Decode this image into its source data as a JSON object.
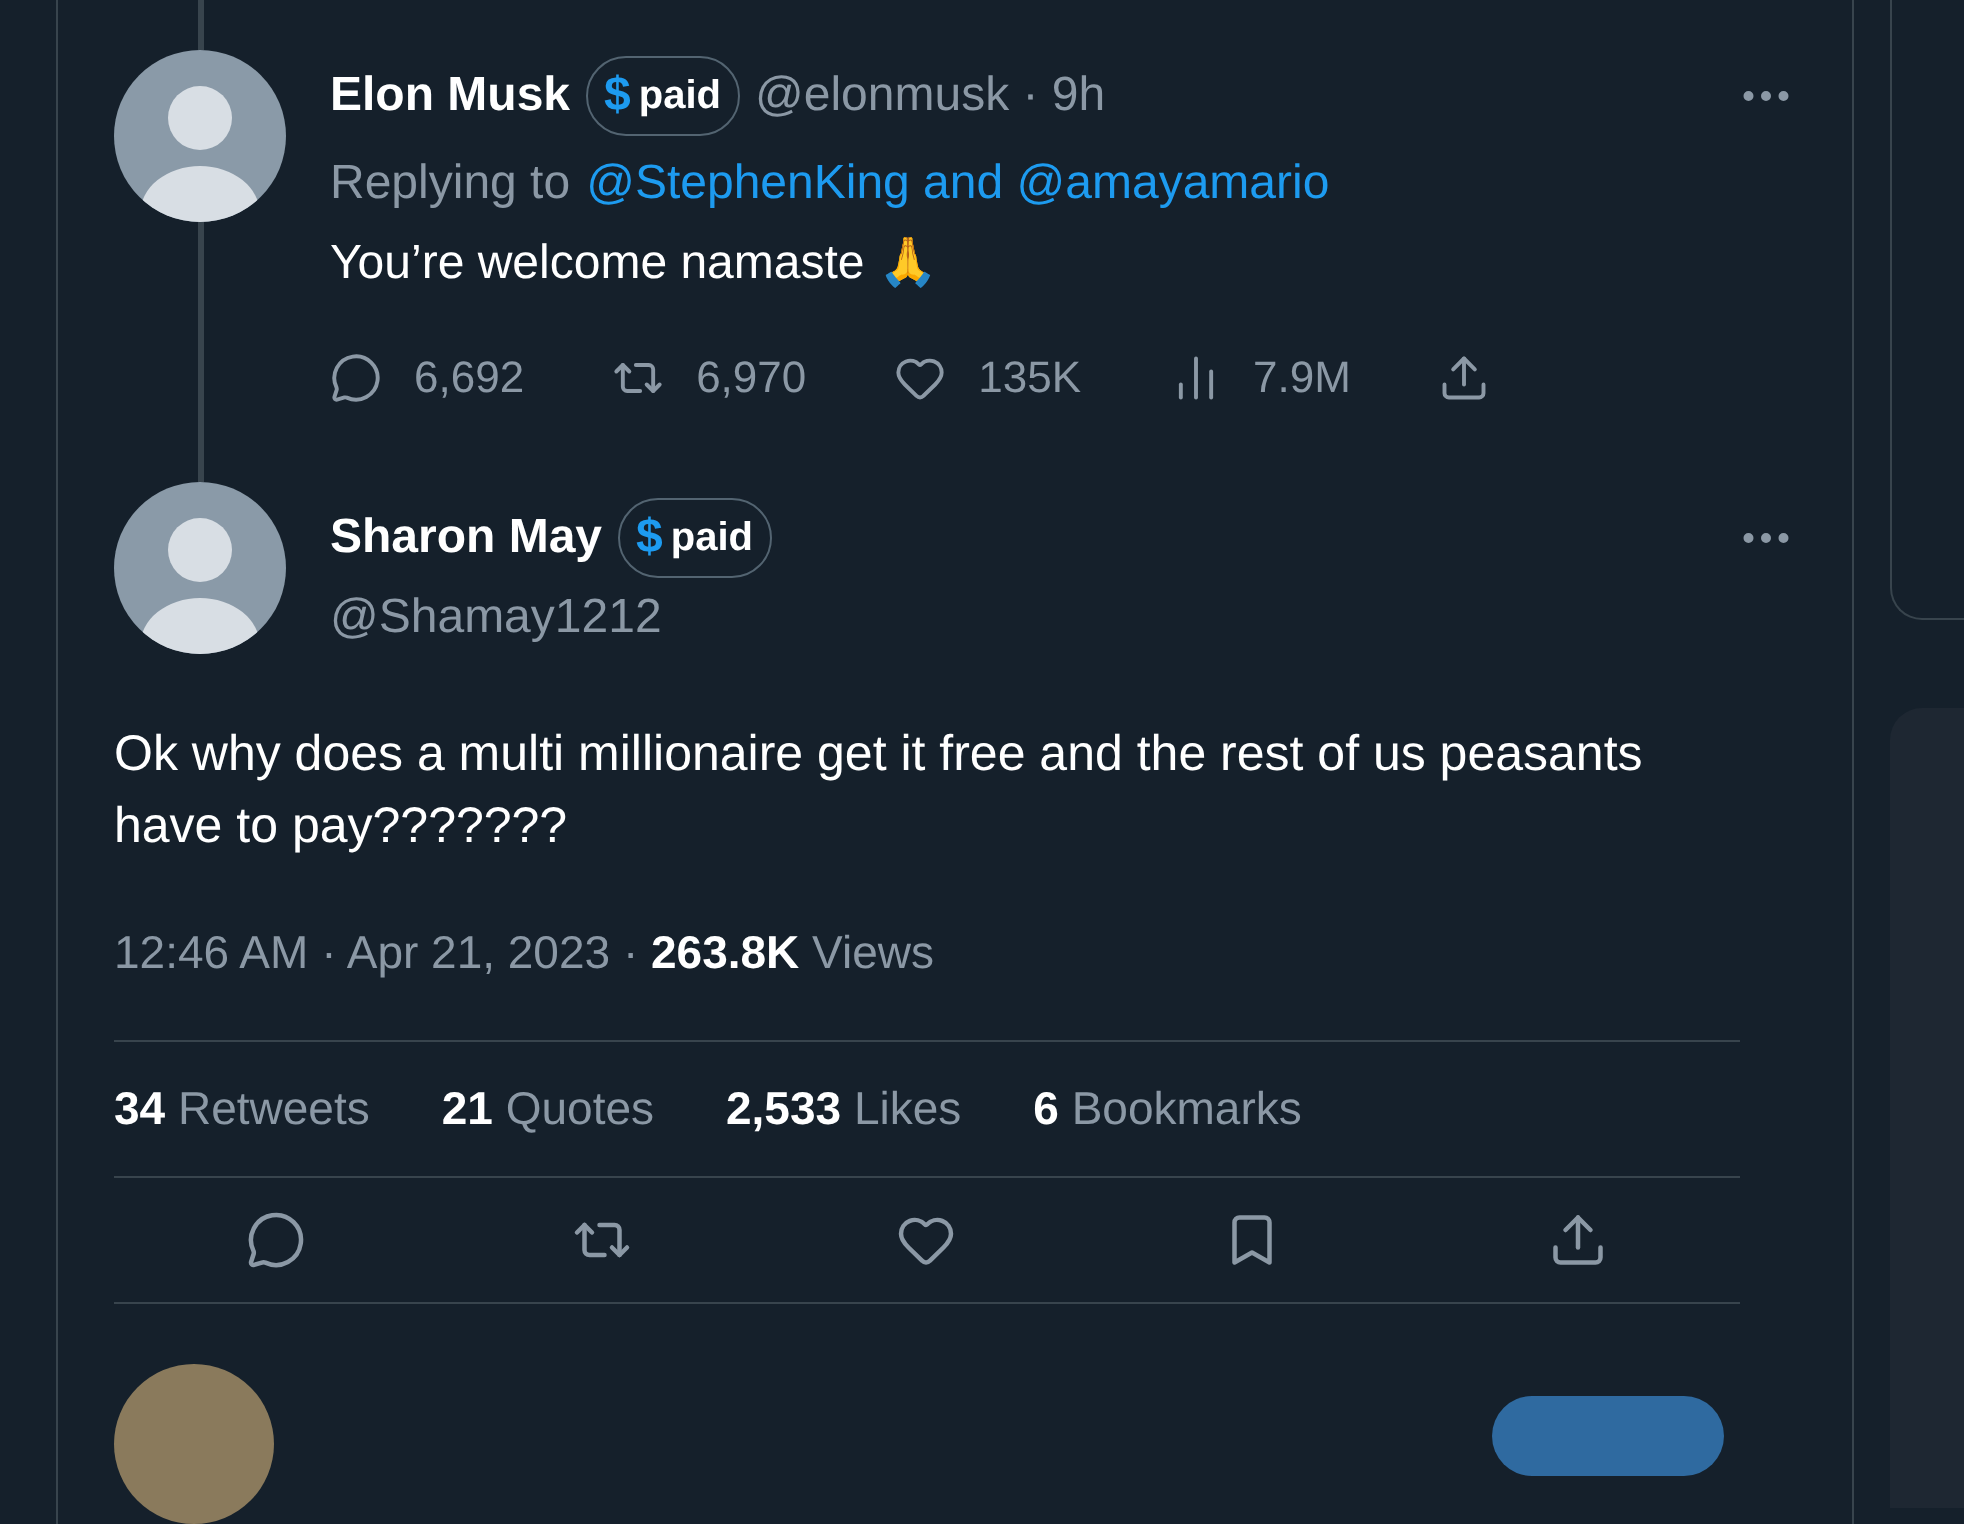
{
  "parent_tweet": {
    "name": "Elon Musk",
    "badge": {
      "symbol": "$",
      "label": "paid"
    },
    "handle": "@elonmusk · 9h",
    "replying_label": "Replying to",
    "replying_to": "@StephenKing and @amayamario",
    "text": "You’re welcome namaste 🙏",
    "actions": [
      {
        "kind": "reply",
        "count": "6,692"
      },
      {
        "kind": "retweet",
        "count": "6,970"
      },
      {
        "kind": "like",
        "count": "135K"
      },
      {
        "kind": "views",
        "count": "7.9M"
      },
      {
        "kind": "share"
      }
    ]
  },
  "main_tweet": {
    "name": "Sharon May",
    "badge": {
      "symbol": "$",
      "label": "paid"
    },
    "handle": "@Shamay1212",
    "text": "Ok why does a multi millionaire get it free and the rest of us peasants have to pay???????",
    "meta": "12:46 AM · Apr 21, 2023 · **263.8K** Views",
    "stats": [
      "**34** Retweets",
      "**21** Quotes",
      "**2,533** Likes",
      "**6** Bookmarks"
    ],
    "actions": [
      {
        "kind": "reply"
      },
      {
        "kind": "retweet"
      },
      {
        "kind": "like"
      },
      {
        "kind": "bookmark"
      },
      {
        "kind": "share"
      }
    ]
  }
}
